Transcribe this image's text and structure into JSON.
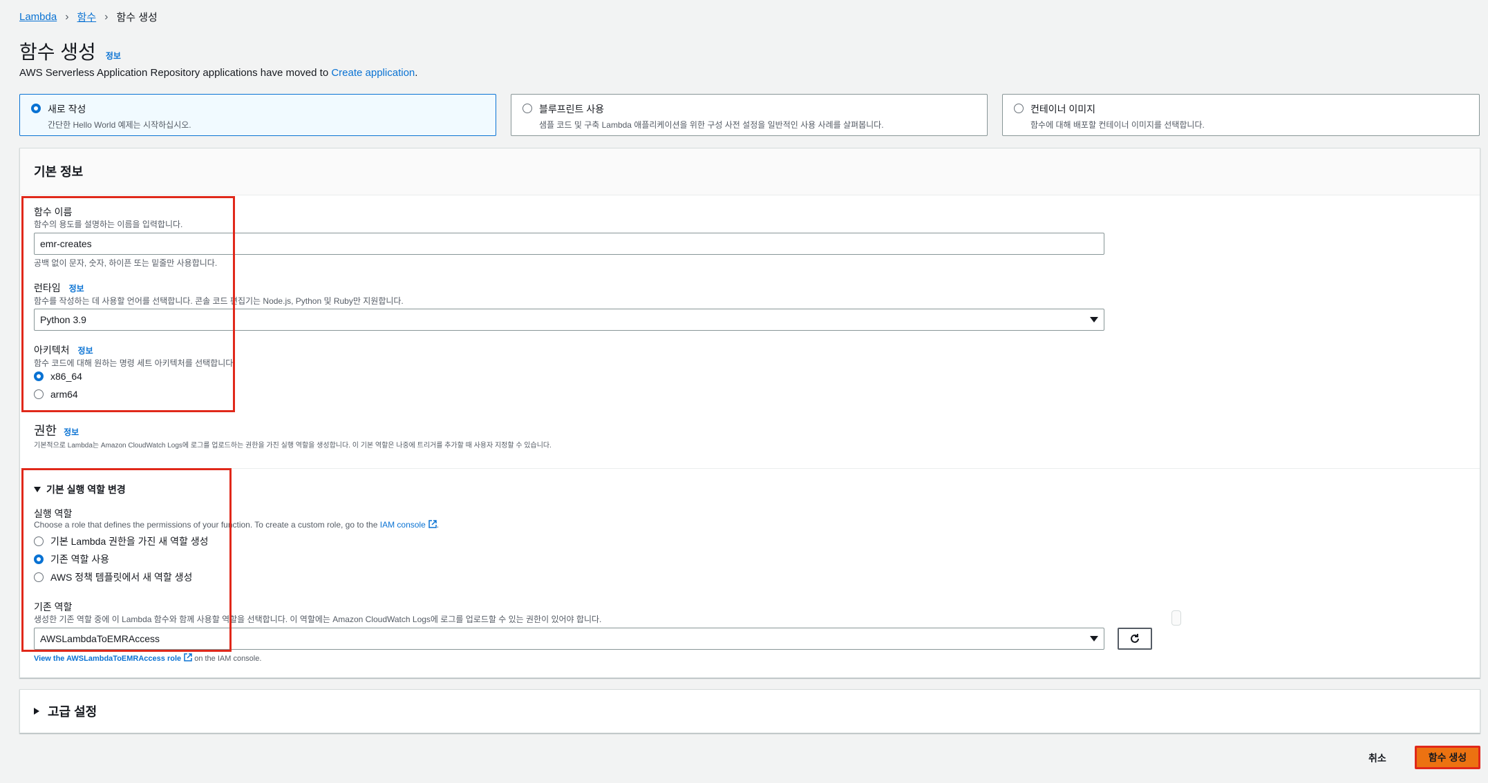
{
  "breadcrumb": {
    "items": [
      "Lambda",
      "함수",
      "함수 생성"
    ]
  },
  "page": {
    "title": "함수 생성",
    "info": "정보",
    "subtitle_text": "AWS Serverless Application Repository applications have moved to ",
    "subtitle_link": "Create application",
    "subtitle_end": "."
  },
  "options": [
    {
      "title": "새로 작성",
      "desc": "간단한 Hello World 예제는 시작하십시오.",
      "selected": true
    },
    {
      "title": "블루프린트 사용",
      "desc": "샘플 코드 및 구축 Lambda 애플리케이션을 위한 구성 사전 설정을 일반적인 사용 사례를 살펴봅니다.",
      "selected": false
    },
    {
      "title": "컨테이너 이미지",
      "desc": "함수에 대해 배포할 컨테이너 이미지를 선택합니다.",
      "selected": false
    }
  ],
  "basic": {
    "header": "기본 정보",
    "function_name": {
      "label": "함수 이름",
      "desc": "함수의 용도를 설명하는 이름을 입력합니다.",
      "value": "emr-creates",
      "constraint": "공백 없이 문자, 숫자, 하이픈 또는 밑줄만 사용합니다."
    },
    "runtime": {
      "label": "런타임",
      "info": "정보",
      "desc": "함수를 작성하는 데 사용할 언어를 선택합니다. 콘솔 코드 편집기는 Node.js, Python 및 Ruby만 지원합니다.",
      "value": "Python 3.9"
    },
    "architecture": {
      "label": "아키텍처",
      "info": "정보",
      "desc": "함수 코드에 대해 원하는 명령 세트 아키텍처를 선택합니다.",
      "options": [
        "x86_64",
        "arm64"
      ],
      "selected": "x86_64"
    },
    "permissions": {
      "label": "권한",
      "info": "정보",
      "desc": "기본적으로 Lambda는 Amazon CloudWatch Logs에 로그를 업로드하는 권한을 가진 실행 역할을 생성합니다. 이 기본 역할은 나중에 트리거를 추가할 때 사용자 지정할 수 있습니다."
    },
    "exec_role_toggle": "기본 실행 역할 변경",
    "exec_role": {
      "label": "실행 역할",
      "desc": "Choose a role that defines the permissions of your function. To create a custom role, go to the ",
      "desc_link": "IAM console",
      "desc_end": ".",
      "options": [
        "기본 Lambda 권한을 가진 새 역할 생성",
        "기존 역할 사용",
        "AWS 정책 템플릿에서 새 역할 생성"
      ],
      "selected": "기존 역할 사용"
    },
    "existing_role": {
      "label": "기존 역할",
      "desc": "생성한 기존 역할 중에 이 Lambda 함수와 함께 사용할 역할을 선택합니다. 이 역할에는 Amazon CloudWatch Logs에 로그를 업로드할 수 있는 권한이 있어야 합니다.",
      "value": "AWSLambdaToEMRAccess",
      "view_link": "View the AWSLambdaToEMRAccess role",
      "view_suffix": " on the IAM console."
    }
  },
  "advanced": {
    "header": "고급 설정"
  },
  "footer": {
    "cancel": "취소",
    "create": "함수 생성"
  },
  "colors": {
    "accent": "#0972d3",
    "primary_button": "#ec7211",
    "highlight": "#e0281a"
  }
}
